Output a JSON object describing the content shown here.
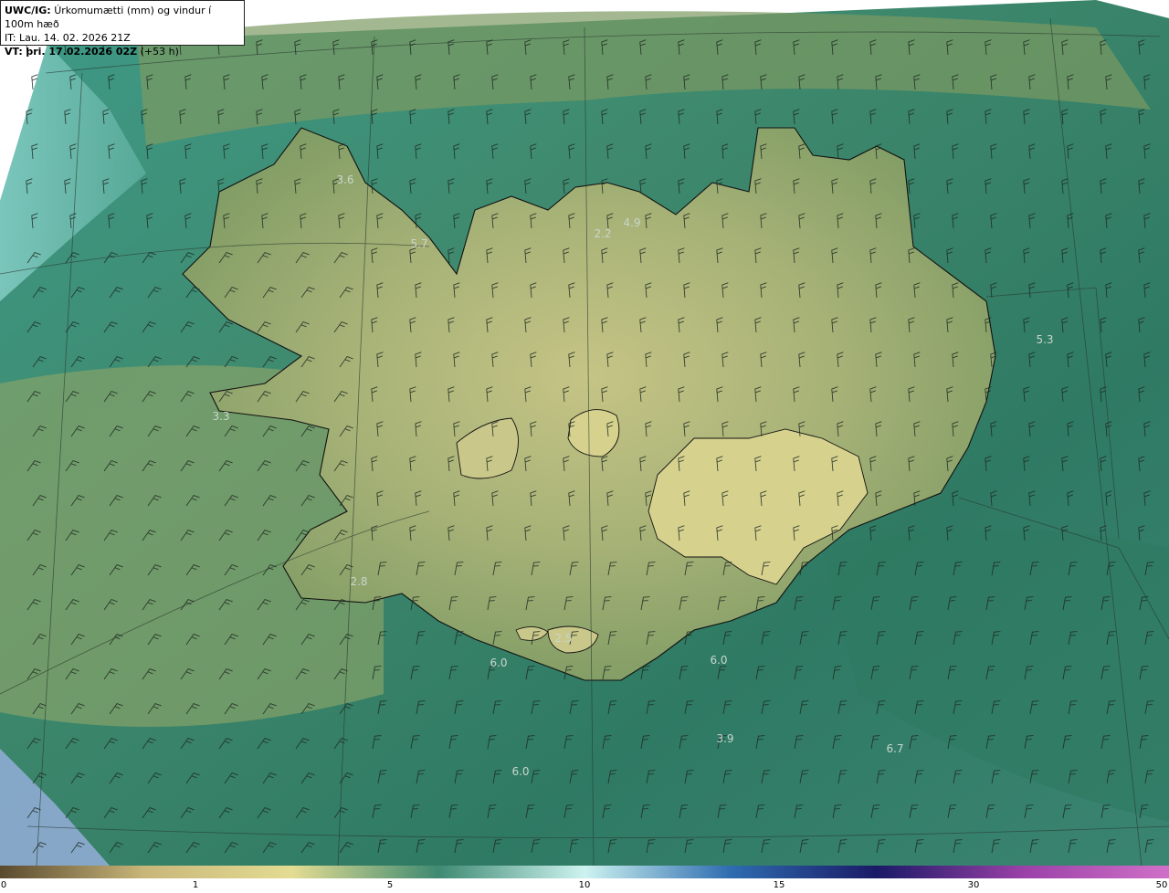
{
  "header": {
    "model": "UWC/IG:",
    "title": "Úrkomumætti (mm) og vindur í 100m hæð",
    "it_label": "IT:",
    "it_value": "Lau. 14. 02. 2026 21Z",
    "vt_label": "VT:",
    "vt_value": "þri. 17.02.2026 02Z",
    "lead": "(+53 h)"
  },
  "values": [
    {
      "label": "3.6"
    },
    {
      "label": "5.7"
    },
    {
      "label": "2.2"
    },
    {
      "label": "4.9"
    },
    {
      "label": "5.3"
    },
    {
      "label": "3.3"
    },
    {
      "label": "2.8"
    },
    {
      "label": "6.0"
    },
    {
      "label": "2.5"
    },
    {
      "label": "6.0"
    },
    {
      "label": "3.9"
    },
    {
      "label": "6.7"
    },
    {
      "label": "6.0"
    }
  ],
  "colorbar": {
    "ticks": [
      "0",
      "1",
      "5",
      "10",
      "15",
      "30",
      "50"
    ],
    "stops": [
      "#5a4a2e",
      "#c9b77a",
      "#e3dc92",
      "#3f8a72",
      "#cdf3f0",
      "#2e6cb0",
      "#1a1a66",
      "#9a40a8",
      "#d070c8"
    ]
  },
  "colors": {
    "sea": "#2f7f68",
    "land": "#8fa86a",
    "land_high": "#c8c78a",
    "coast": "#111111"
  }
}
